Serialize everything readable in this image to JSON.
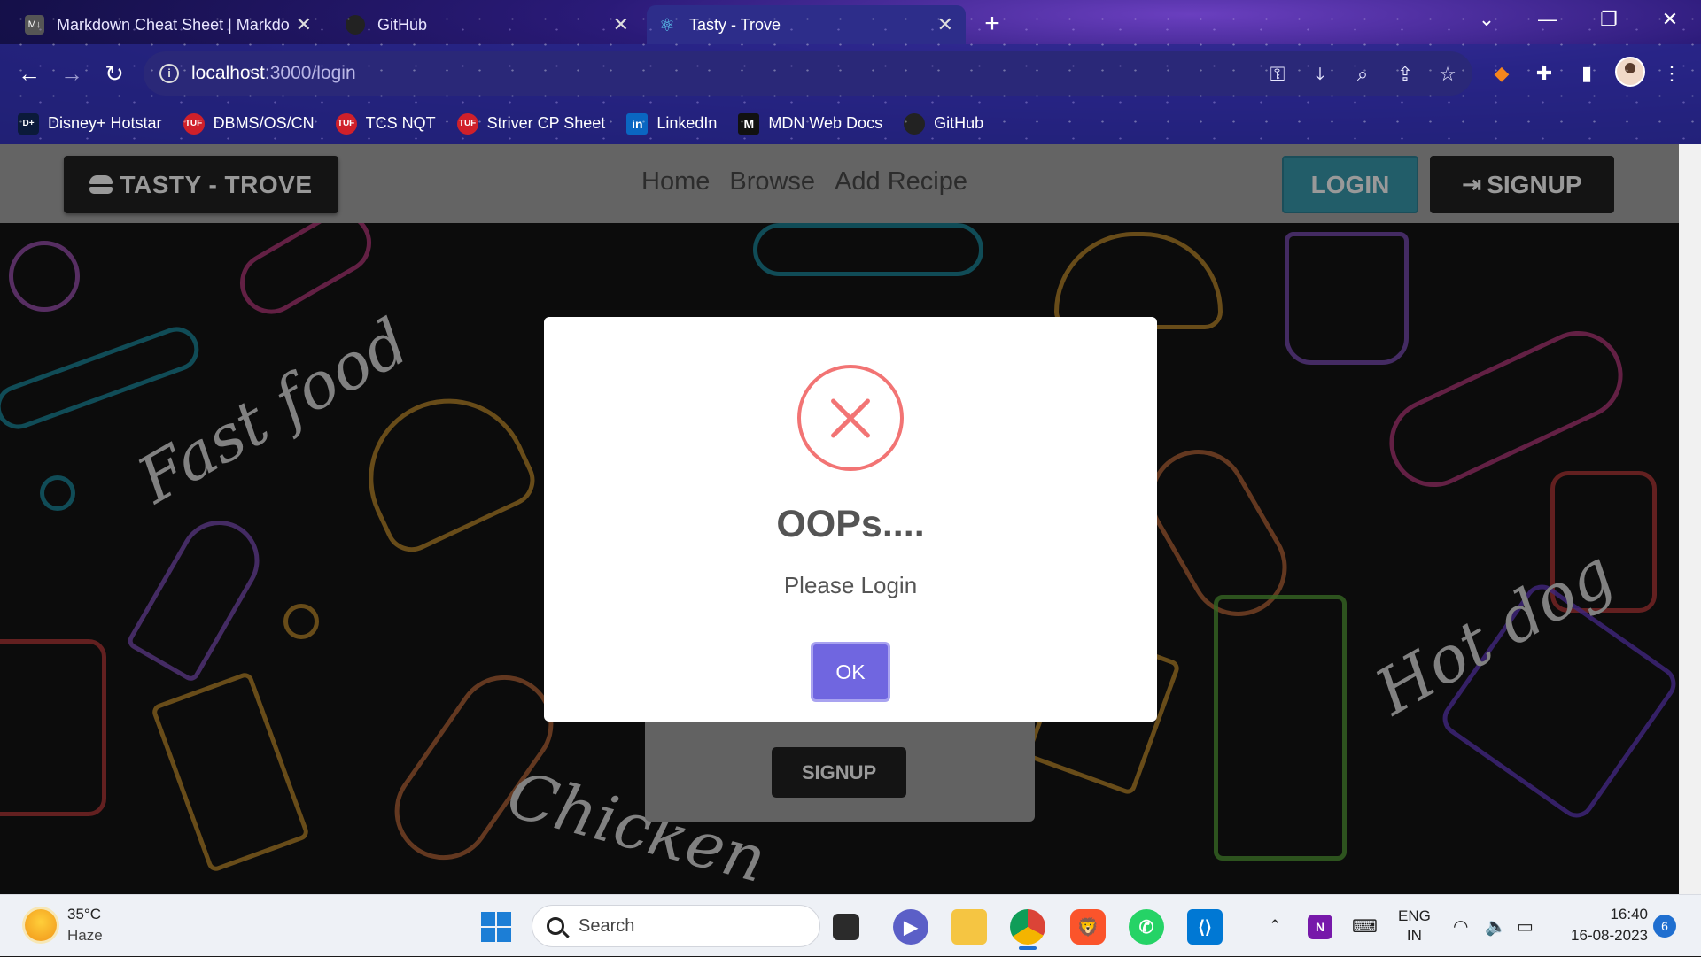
{
  "browser": {
    "tabs": [
      {
        "title": "Markdown Cheat Sheet | Markdo",
        "favicon": "M↓"
      },
      {
        "title": "GitHub",
        "favicon": ""
      },
      {
        "title": "Tasty - Trove",
        "favicon": "⚛"
      }
    ],
    "url_host": "localhost",
    "url_path": ":3000/login",
    "bookmarks": [
      {
        "label": "Disney+ Hotstar",
        "icon": "D+",
        "color": "#0b1a3a"
      },
      {
        "label": "DBMS/OS/CN",
        "icon": "TUF",
        "color": "#d0202a"
      },
      {
        "label": "TCS NQT",
        "icon": "TUF",
        "color": "#d0202a"
      },
      {
        "label": "Striver CP Sheet",
        "icon": "TUF",
        "color": "#d0202a"
      },
      {
        "label": "LinkedIn",
        "icon": "in",
        "color": "#0a66c2"
      },
      {
        "label": "MDN Web Docs",
        "icon": "M",
        "color": "#111111"
      },
      {
        "label": "GitHub",
        "icon": "",
        "color": "#222222"
      }
    ]
  },
  "site": {
    "brand": "TASTY - TROVE",
    "nav_links": [
      "Home",
      "Browse",
      "Add Recipe"
    ],
    "login_label": "LOGIN",
    "signup_label": "SIGNUP",
    "card_signup_label": "SIGNUP",
    "bg_words": [
      "Fast food",
      "Hot dog",
      "Chicken"
    ]
  },
  "modal": {
    "title": "OOPs....",
    "text": "Please Login",
    "ok_label": "OK"
  },
  "taskbar": {
    "temperature": "35°C",
    "weather": "Haze",
    "search_placeholder": "Search",
    "language_1": "ENG",
    "language_2": "IN",
    "time": "16:40",
    "date": "16-08-2023",
    "notifications": "6"
  },
  "colors": {
    "accent_login": "#3a9bb0",
    "modal_ok": "#7066e0",
    "error_red": "#f27474"
  }
}
